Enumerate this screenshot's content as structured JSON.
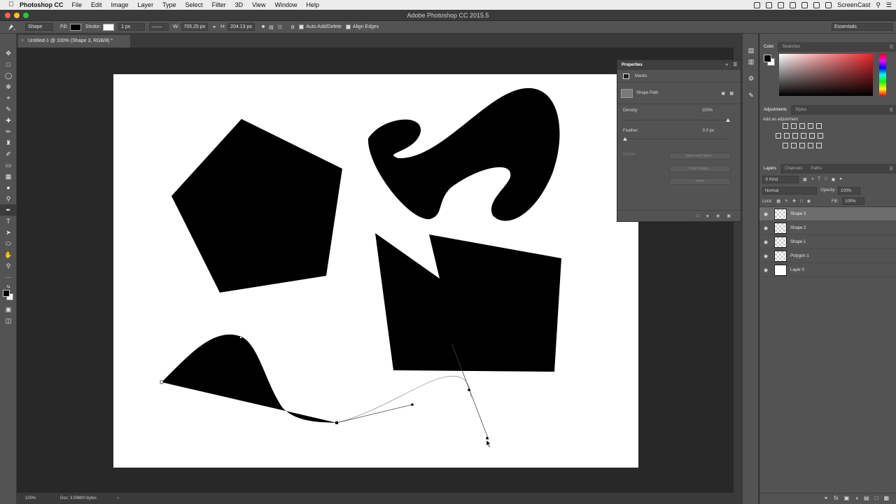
{
  "menubar": {
    "app": "Photoshop CC",
    "items": [
      "File",
      "Edit",
      "Image",
      "Layer",
      "Type",
      "Select",
      "Filter",
      "3D",
      "View",
      "Window",
      "Help"
    ],
    "screencast": "ScreenCast"
  },
  "window_title": "Adobe Photoshop CC 2015.5",
  "options": {
    "mode": "Shape",
    "fill_label": "Fill:",
    "stroke_label": "Stroke:",
    "stroke_width": "1 px",
    "w_label": "W:",
    "w_value": "705.25 px",
    "h_label": "H:",
    "h_value": "204.13 px",
    "auto_add_delete": "Auto Add/Delete",
    "align_edges": "Align Edges",
    "workspace": "Essentials"
  },
  "document": {
    "tab_label": "Untitled-1 @ 100% (Shape 3, RGB/8) *",
    "zoom": "100%",
    "doc_info": "Doc: 3.09M/0 bytes"
  },
  "properties": {
    "title": "Properties",
    "section": "Masks",
    "shape_path": "Shape Path",
    "density_label": "Density:",
    "density_value": "100%",
    "density_level": 1.0,
    "feather_label": "Feather:",
    "feather_value": "0.0 px",
    "refine_label": "Refine:",
    "select_and_mask": "Select and Mask...",
    "color_range": "Color Range...",
    "invert": "Invert"
  },
  "color_panel": {
    "tabs": [
      "Color",
      "Swatches"
    ],
    "hue_color": "#e8242b"
  },
  "adjustments": {
    "tabs": [
      "Adjustments",
      "Styles"
    ],
    "add_label": "Add an adjustment"
  },
  "layers_panel": {
    "tabs": [
      "Layers",
      "Channels",
      "Paths"
    ],
    "filter": "Kind",
    "blend_mode": "Normal",
    "opacity_label": "Opacity:",
    "opacity_value": "100%",
    "lock_label": "Lock:",
    "fill_label": "Fill:",
    "fill_value": "100%",
    "layers": [
      {
        "name": "Shape 3",
        "selected": true
      },
      {
        "name": "Shape 2",
        "selected": false
      },
      {
        "name": "Shape 1",
        "selected": false
      },
      {
        "name": "Polygon 1",
        "selected": false
      },
      {
        "name": "Layer 0",
        "selected": false
      }
    ]
  }
}
